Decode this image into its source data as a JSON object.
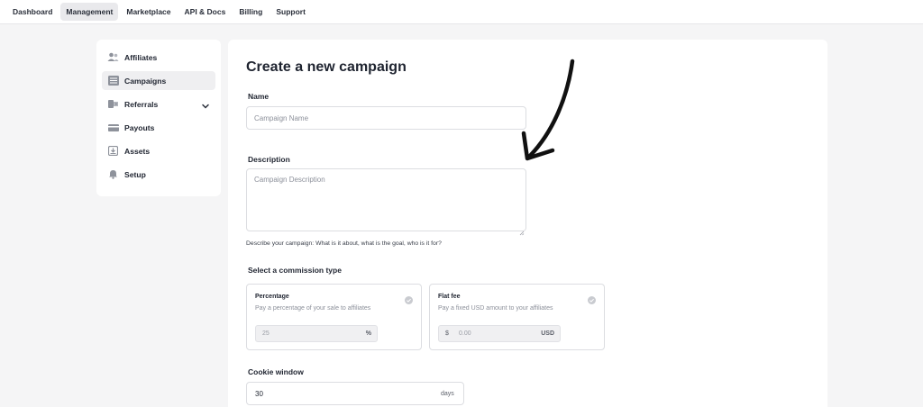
{
  "topnav": {
    "items": [
      {
        "label": "Dashboard"
      },
      {
        "label": "Management",
        "active": true
      },
      {
        "label": "Marketplace"
      },
      {
        "label": "API & Docs"
      },
      {
        "label": "Billing"
      },
      {
        "label": "Support"
      }
    ]
  },
  "sidebar": {
    "items": [
      {
        "label": "Affiliates",
        "icon": "users-icon"
      },
      {
        "label": "Campaigns",
        "icon": "list-icon",
        "active": true
      },
      {
        "label": "Referrals",
        "icon": "referral-icon",
        "expandable": true
      },
      {
        "label": "Payouts",
        "icon": "credit-card-icon"
      },
      {
        "label": "Assets",
        "icon": "download-icon"
      },
      {
        "label": "Setup",
        "icon": "bell-icon"
      }
    ]
  },
  "form": {
    "title": "Create a new campaign",
    "name_label": "Name",
    "name_placeholder": "Campaign Name",
    "description_label": "Description",
    "description_placeholder": "Campaign Description",
    "description_help": "Describe your campaign: What is it about, what is the goal, who is it for?",
    "commission_label": "Select a commission type",
    "percentage": {
      "title": "Percentage",
      "desc": "Pay a percentage of your sale to affiliates",
      "value": "25",
      "suffix": "%"
    },
    "flat_fee": {
      "title": "Flat fee",
      "desc": "Pay a fixed USD amount to your affiliates",
      "prefix": "$",
      "value": "0.00",
      "suffix": "USD"
    },
    "cookie_label": "Cookie window",
    "cookie_value": "30",
    "cookie_suffix": "days"
  },
  "colors": {
    "page_bg": "#f5f5f6",
    "card_bg": "#ffffff",
    "border": "#dcdde1",
    "annotation_arrow": "#111111"
  }
}
